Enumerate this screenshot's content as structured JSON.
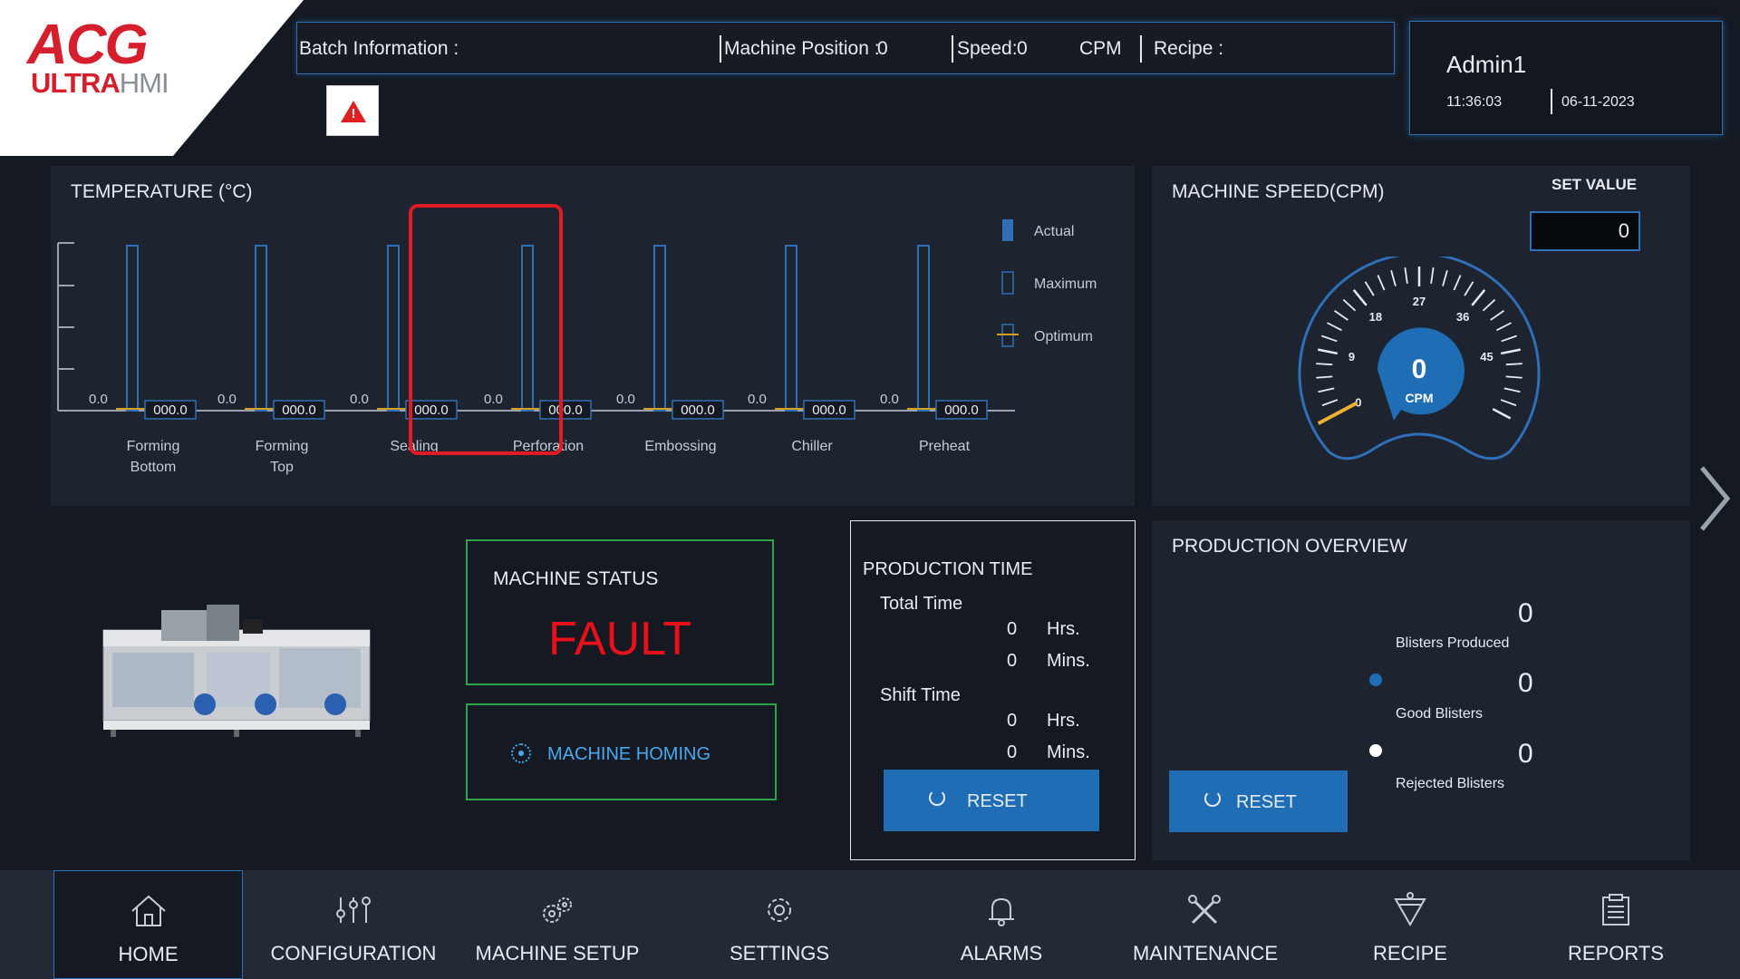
{
  "logo": {
    "brand": "ACG",
    "product_prefix": "ULTRA",
    "product_suffix": "HMI"
  },
  "header": {
    "batch_label": "Batch Information :",
    "machine_position_label": "Machine Position :",
    "machine_position_value": "0",
    "speed_label": "Speed:",
    "speed_value": "0",
    "speed_unit": "CPM",
    "recipe_label": "Recipe :"
  },
  "user": {
    "name": "Admin1",
    "time": "11:36:03",
    "date": "06-11-2023"
  },
  "temperature": {
    "title": "TEMPERATURE (°C)",
    "legend": [
      "Actual",
      "Maximum",
      "Optimum"
    ],
    "zones": [
      {
        "name": "Forming\nBottom",
        "value_label": "0.0",
        "setpoint": "000.0"
      },
      {
        "name": "Forming\nTop",
        "value_label": "0.0",
        "setpoint": "000.0"
      },
      {
        "name": "Sealing",
        "value_label": "0.0",
        "setpoint": "000.0"
      },
      {
        "name": "Perforation",
        "value_label": "0.0",
        "setpoint": "000.0"
      },
      {
        "name": "Embossing",
        "value_label": "0.0",
        "setpoint": "000.0"
      },
      {
        "name": "Chiller",
        "value_label": "0.0",
        "setpoint": "000.0"
      },
      {
        "name": "Preheat",
        "value_label": "0.0",
        "setpoint": "000.0"
      }
    ]
  },
  "speed": {
    "title": "MACHINE SPEED(CPM)",
    "set_value_label": "SET VALUE",
    "set_value": "0",
    "gauge_value": "0",
    "gauge_unit": "CPM",
    "scale_labels": [
      "0",
      "9",
      "18",
      "27",
      "36",
      "45"
    ]
  },
  "status": {
    "label": "MACHINE STATUS",
    "value": "FAULT",
    "homing_label": "MACHINE HOMING"
  },
  "production_time": {
    "title": "PRODUCTION TIME",
    "total_label": "Total Time",
    "total_hrs": "0",
    "total_mins": "0",
    "shift_label": "Shift Time",
    "shift_hrs": "0",
    "shift_mins": "0",
    "hrs_unit": "Hrs.",
    "mins_unit": "Mins.",
    "reset_label": "RESET"
  },
  "production_overview": {
    "title": "PRODUCTION OVERVIEW",
    "reset_label": "RESET",
    "produced_value": "0",
    "produced_label": "Blisters Produced",
    "good_value": "0",
    "good_label": "Good Blisters",
    "rejected_value": "0",
    "rejected_label": "Rejected Blisters",
    "good_color": "#1f6db4",
    "rejected_color": "#ffffff"
  },
  "nav": [
    {
      "label": "HOME",
      "icon": "home-icon",
      "active": true
    },
    {
      "label": "CONFIGURATION",
      "icon": "sliders-icon"
    },
    {
      "label": "MACHINE SETUP",
      "icon": "gears-icon"
    },
    {
      "label": "SETTINGS",
      "icon": "gear-icon"
    },
    {
      "label": "ALARMS",
      "icon": "bell-icon"
    },
    {
      "label": "MAINTENANCE",
      "icon": "tools-icon"
    },
    {
      "label": "RECIPE",
      "icon": "recipe-icon"
    },
    {
      "label": "REPORTS",
      "icon": "clipboard-icon"
    }
  ],
  "colors": {
    "accent": "#2f6fb7",
    "fault": "#e8101a",
    "status_border": "#2fa34a",
    "button": "#1f6db4",
    "gauge_needle": "#f0b030"
  }
}
